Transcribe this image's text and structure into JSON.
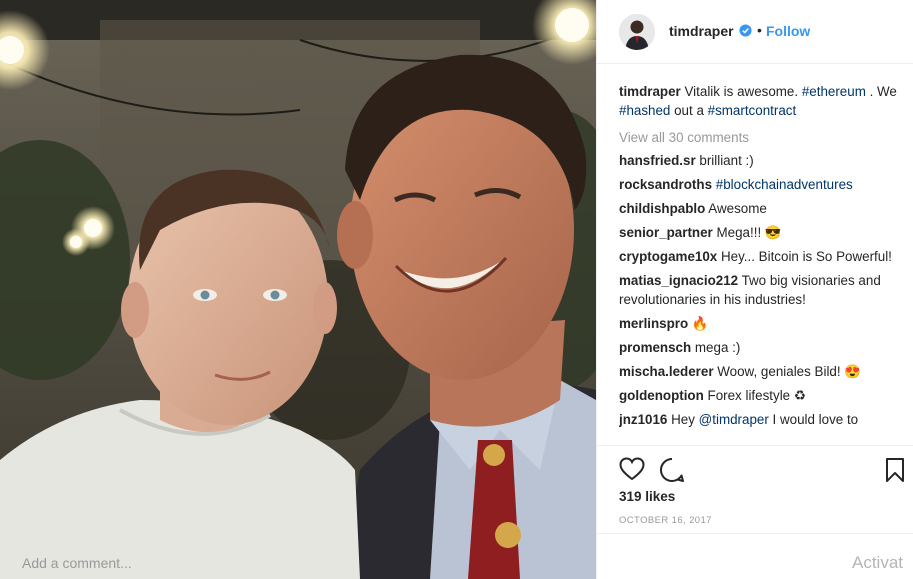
{
  "post": {
    "username": "timdraper",
    "separator": "•",
    "follow_label": "Follow",
    "caption": {
      "user": "timdraper",
      "parts": [
        {
          "text": " Vitalik is awesome. "
        },
        {
          "text": "#ethereum",
          "tag": true
        },
        {
          "text": " . We "
        },
        {
          "text": "#hashed",
          "tag": true
        },
        {
          "text": " out a "
        },
        {
          "text": "#smartcontract",
          "tag": true
        }
      ]
    },
    "view_all": "View all 30 comments",
    "comments": [
      {
        "user": "hansfried.sr",
        "text": " brilliant :)"
      },
      {
        "user": "rocksandroths",
        "text": " ",
        "tag": "#blockchainadventures"
      },
      {
        "user": "childishpablo",
        "text": " Awesome"
      },
      {
        "user": "senior_partner",
        "text": " Mega!!! 😎"
      },
      {
        "user": "cryptogame10x",
        "text": " Hey... Bitcoin is So Powerful!"
      },
      {
        "user": "matias_ignacio212",
        "text": " Two big visionaries and revolutionaries in his industries!"
      },
      {
        "user": "merlinspro",
        "text": " 🔥"
      },
      {
        "user": "promensch",
        "text": " mega :)"
      },
      {
        "user": "mischa.lederer",
        "text": " Woow, geniales Bild! 😍"
      },
      {
        "user": "goldenoption",
        "text": " Forex lifestyle ♻"
      },
      {
        "user": "jnz1016",
        "text": " Hey ",
        "mention": "@timdraper",
        "text2": " I would love to"
      }
    ],
    "likes": "319 likes",
    "date": "OCTOBER 16, 2017",
    "add_comment_placeholder": "Add a comment...",
    "watermark": "Activat"
  },
  "colors": {
    "link_blue": "#3897f0",
    "hashtag": "#003569",
    "muted": "#999999",
    "text": "#262626"
  },
  "icons": [
    "verified-badge-icon",
    "heart-icon",
    "comment-icon",
    "bookmark-icon"
  ]
}
